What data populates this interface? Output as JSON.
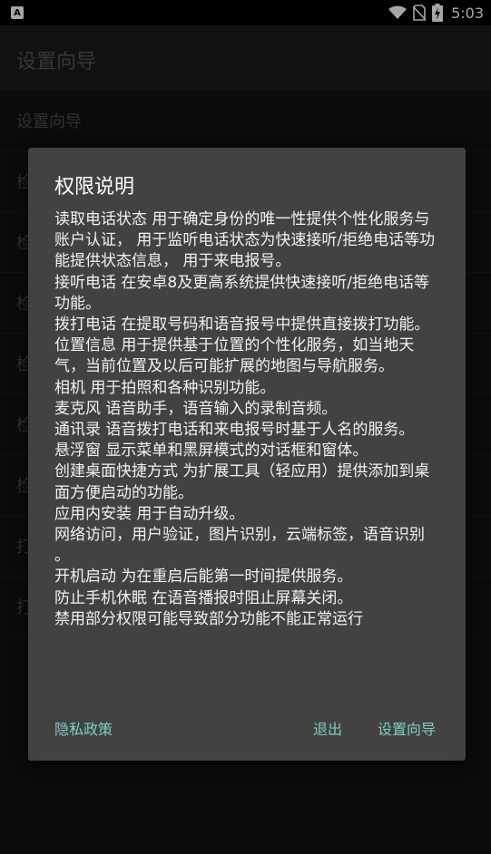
{
  "status_bar": {
    "left_icon_glyph": "A",
    "time": "5:03",
    "icons": [
      "wifi-icon",
      "no-sim-icon",
      "battery-charging-icon"
    ]
  },
  "app_bar": {
    "title": "设置向导"
  },
  "list": {
    "items": [
      {
        "label": "设置向导"
      },
      {
        "label": "检"
      },
      {
        "label": "检"
      },
      {
        "label": "检"
      },
      {
        "label": "检"
      },
      {
        "label": "检"
      },
      {
        "label": "检"
      },
      {
        "label": "打"
      },
      {
        "label": "打"
      }
    ]
  },
  "dialog": {
    "title": "权限说明",
    "message": "读取电话状态 用于确定身份的唯一性提供个性化服务与账户认证， 用于监听电话状态为快速接听/拒绝电话等功能提供状态信息， 用于来电报号。\n 接听电话 在安卓8及更高系统提供快速接听/拒绝电话等功能。\n 拨打电话 在提取号码和语音报号中提供直接拨打功能。\n 位置信息 用于提供基于位置的个性化服务，如当地天气，当前位置及以后可能扩展的地图与导航服务。\n 相机 用于拍照和各种识别功能。\n 麦克风 语音助手，语音输入的录制音频。\n 通讯录 语音拨打电话和来电报号时基于人名的服务。\n 悬浮窗 显示菜单和黑屏模式的对话框和窗体。\n 创建桌面快捷方式 为扩展工具（轻应用）提供添加到桌面方便启动的功能。\n 应用内安装 用于自动升级。\n 网络访问，用户验证，图片识别，云端标签，语音识别 。\n 开机启动 为在重启后能第一时间提供服务。\n 防止手机休眠 在语音播报时阻止屏幕关闭。\n 禁用部分权限可能导致部分功能不能正常运行",
    "buttons": {
      "privacy": "隐私政策",
      "exit": "退出",
      "setup": "设置向导"
    }
  },
  "colors": {
    "accent": "#80cbc4",
    "dialog_bg": "#424242",
    "page_bg": "#121212"
  }
}
